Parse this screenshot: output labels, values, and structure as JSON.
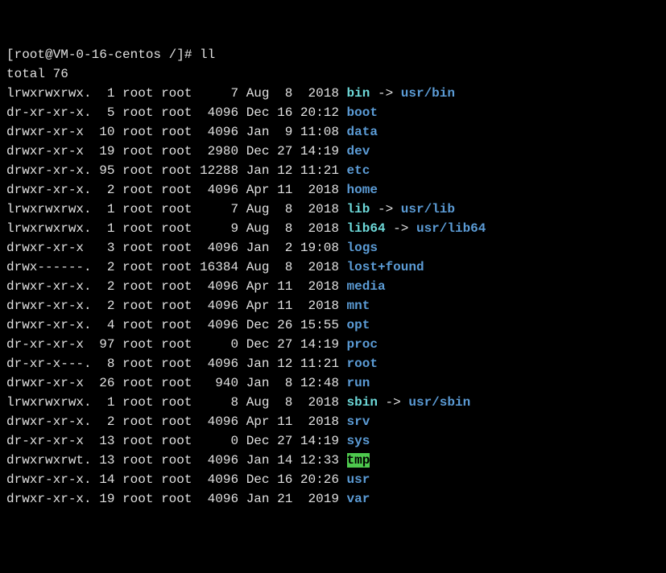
{
  "prompt": {
    "full": "[root@VM-0-16-centos /]# ",
    "command": "ll"
  },
  "total_line": "total 76",
  "entries": [
    {
      "perms": "lrwxrwxrwx.",
      "links": "1",
      "owner": "root",
      "group": "root",
      "size": "7",
      "month": "Aug",
      "day": "8",
      "time": "2018",
      "name": "bin",
      "type": "link",
      "target": "usr/bin"
    },
    {
      "perms": "dr-xr-xr-x.",
      "links": "5",
      "owner": "root",
      "group": "root",
      "size": "4096",
      "month": "Dec",
      "day": "16",
      "time": "20:12",
      "name": "boot",
      "type": "dir"
    },
    {
      "perms": "drwxr-xr-x",
      "links": "10",
      "owner": "root",
      "group": "root",
      "size": "4096",
      "month": "Jan",
      "day": "9",
      "time": "11:08",
      "name": "data",
      "type": "dir"
    },
    {
      "perms": "drwxr-xr-x",
      "links": "19",
      "owner": "root",
      "group": "root",
      "size": "2980",
      "month": "Dec",
      "day": "27",
      "time": "14:19",
      "name": "dev",
      "type": "dir"
    },
    {
      "perms": "drwxr-xr-x.",
      "links": "95",
      "owner": "root",
      "group": "root",
      "size": "12288",
      "month": "Jan",
      "day": "12",
      "time": "11:21",
      "name": "etc",
      "type": "dir"
    },
    {
      "perms": "drwxr-xr-x.",
      "links": "2",
      "owner": "root",
      "group": "root",
      "size": "4096",
      "month": "Apr",
      "day": "11",
      "time": "2018",
      "name": "home",
      "type": "dir"
    },
    {
      "perms": "lrwxrwxrwx.",
      "links": "1",
      "owner": "root",
      "group": "root",
      "size": "7",
      "month": "Aug",
      "day": "8",
      "time": "2018",
      "name": "lib",
      "type": "link",
      "target": "usr/lib"
    },
    {
      "perms": "lrwxrwxrwx.",
      "links": "1",
      "owner": "root",
      "group": "root",
      "size": "9",
      "month": "Aug",
      "day": "8",
      "time": "2018",
      "name": "lib64",
      "type": "link",
      "target": "usr/lib64"
    },
    {
      "perms": "drwxr-xr-x",
      "links": "3",
      "owner": "root",
      "group": "root",
      "size": "4096",
      "month": "Jan",
      "day": "2",
      "time": "19:08",
      "name": "logs",
      "type": "dir"
    },
    {
      "perms": "drwx------.",
      "links": "2",
      "owner": "root",
      "group": "root",
      "size": "16384",
      "month": "Aug",
      "day": "8",
      "time": "2018",
      "name": "lost+found",
      "type": "dir"
    },
    {
      "perms": "drwxr-xr-x.",
      "links": "2",
      "owner": "root",
      "group": "root",
      "size": "4096",
      "month": "Apr",
      "day": "11",
      "time": "2018",
      "name": "media",
      "type": "dir"
    },
    {
      "perms": "drwxr-xr-x.",
      "links": "2",
      "owner": "root",
      "group": "root",
      "size": "4096",
      "month": "Apr",
      "day": "11",
      "time": "2018",
      "name": "mnt",
      "type": "dir"
    },
    {
      "perms": "drwxr-xr-x.",
      "links": "4",
      "owner": "root",
      "group": "root",
      "size": "4096",
      "month": "Dec",
      "day": "26",
      "time": "15:55",
      "name": "opt",
      "type": "dir"
    },
    {
      "perms": "dr-xr-xr-x",
      "links": "97",
      "owner": "root",
      "group": "root",
      "size": "0",
      "month": "Dec",
      "day": "27",
      "time": "14:19",
      "name": "proc",
      "type": "dir"
    },
    {
      "perms": "dr-xr-x---.",
      "links": "8",
      "owner": "root",
      "group": "root",
      "size": "4096",
      "month": "Jan",
      "day": "12",
      "time": "11:21",
      "name": "root",
      "type": "dir"
    },
    {
      "perms": "drwxr-xr-x",
      "links": "26",
      "owner": "root",
      "group": "root",
      "size": "940",
      "month": "Jan",
      "day": "8",
      "time": "12:48",
      "name": "run",
      "type": "dir"
    },
    {
      "perms": "lrwxrwxrwx.",
      "links": "1",
      "owner": "root",
      "group": "root",
      "size": "8",
      "month": "Aug",
      "day": "8",
      "time": "2018",
      "name": "sbin",
      "type": "link",
      "target": "usr/sbin"
    },
    {
      "perms": "drwxr-xr-x.",
      "links": "2",
      "owner": "root",
      "group": "root",
      "size": "4096",
      "month": "Apr",
      "day": "11",
      "time": "2018",
      "name": "srv",
      "type": "dir"
    },
    {
      "perms": "dr-xr-xr-x",
      "links": "13",
      "owner": "root",
      "group": "root",
      "size": "0",
      "month": "Dec",
      "day": "27",
      "time": "14:19",
      "name": "sys",
      "type": "dir"
    },
    {
      "perms": "drwxrwxrwt.",
      "links": "13",
      "owner": "root",
      "group": "root",
      "size": "4096",
      "month": "Jan",
      "day": "14",
      "time": "12:33",
      "name": "tmp",
      "type": "sticky"
    },
    {
      "perms": "drwxr-xr-x.",
      "links": "14",
      "owner": "root",
      "group": "root",
      "size": "4096",
      "month": "Dec",
      "day": "16",
      "time": "20:26",
      "name": "usr",
      "type": "dir"
    },
    {
      "perms": "drwxr-xr-x.",
      "links": "19",
      "owner": "root",
      "group": "root",
      "size": "4096",
      "month": "Jan",
      "day": "21",
      "time": "2019",
      "name": "var",
      "type": "dir"
    }
  ]
}
